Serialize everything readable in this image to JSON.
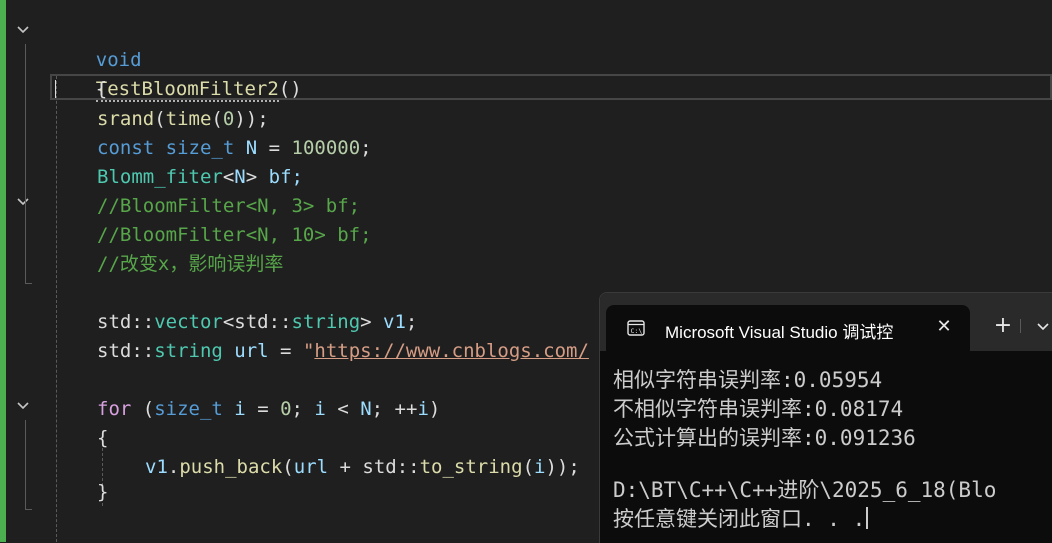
{
  "editor": {
    "signature": {
      "return_type": "void",
      "name": "TestBloomFilter2",
      "parens": "()"
    },
    "open_brace": "{",
    "lines": {
      "srand": {
        "fn": "srand",
        "p1": "(",
        "fn2": "time",
        "p2": "(",
        "num": "0",
        "p3": "));"
      },
      "const": {
        "kw": "const",
        "type": "size_t",
        "var": "N",
        "op": " = ",
        "num": "100000",
        "end": ";"
      },
      "blomm": {
        "type": "Blomm_fiter",
        "lt": "<",
        "var": "N",
        "gt": ">",
        "rest": " bf;"
      },
      "comment1": "//BloomFilter<N, 3> bf;",
      "comment2": "//BloomFilter<N, 10> bf;",
      "comment3": "//改变x，影响误判率",
      "vector": {
        "ns": "std::",
        "type": "vector",
        "lt": "<",
        "ns2": "std::",
        "type2": "string",
        "gt": ">",
        "var": " v1",
        "end": ";"
      },
      "url": {
        "ns": "std::",
        "type": "string",
        "var": " url",
        "op": " = ",
        "q": "\"",
        "link": "https://www.cnblogs.com/"
      },
      "for": {
        "kw": "for",
        "p1": " (",
        "type": "size_t",
        "var": " i",
        "op": " = ",
        "num": "0",
        "s1": "; ",
        "var2": "i",
        "lt": " < ",
        "var3": "N",
        "s2": "; ",
        "inc": "++",
        "var4": "i",
        "p2": ")"
      },
      "for_open": "{",
      "push": {
        "var": "v1",
        "dot": ".",
        "fn": "push_back",
        "p1": "(",
        "var2": "url",
        "op": " + ",
        "ns": "std::",
        "fn2": "to_string",
        "p2": "(",
        "var3": "i",
        "p3": "));"
      },
      "for_close": "}"
    }
  },
  "console": {
    "tab_title": "Microsoft Visual Studio 调试控",
    "tab_icon": "terminal-icon",
    "close_symbol": "✕",
    "new_tab_symbol": "+",
    "output": [
      "相似字符串误判率:0.05954",
      "不相似字符串误判率:0.08174",
      "公式计算出的误判率:0.091236",
      "",
      "D:\\BT\\C++\\C++进阶\\2025_6_18(Blo",
      "按任意键关闭此窗口. . ."
    ]
  },
  "colors": {
    "editor_bg": "#1f1f1f",
    "keyword": "#569cd6",
    "function": "#dcdcaa",
    "type": "#4ec9b0",
    "variable": "#9cdcfe",
    "comment": "#57a64a",
    "string": "#d69d85",
    "git_change_bar": "#4caf50",
    "console_bg": "#0c0c0c"
  }
}
